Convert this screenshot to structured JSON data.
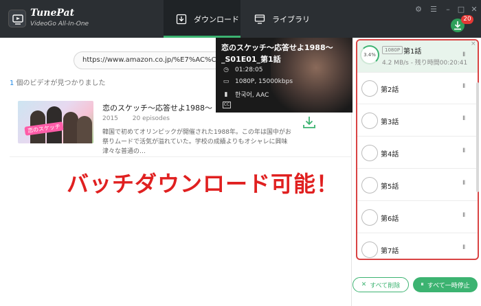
{
  "app": {
    "brand": "TunePat",
    "subtitle": "VideoGo All-In-One"
  },
  "nav": {
    "download": "ダウンロード",
    "library": "ライブラリ"
  },
  "badge": {
    "count": "20"
  },
  "search": {
    "url": "https://www.amazon.co.jp/%E7%AC%C19%E8%"
  },
  "results": {
    "count": "1",
    "suffix": " 個のビデオが見つかりました"
  },
  "video": {
    "title": "恋のスケッチ～応答せよ1988～",
    "year": "2015",
    "episodes": "20 episodes",
    "description": "韓国で初めてオリンピックが開催された1988年。この年は国中がお祭りムードで活気が溢れていた。学校の成績よりもオシャレに興味津々な普通の…",
    "thumb_tag": "恋のスケッチ"
  },
  "popover": {
    "title": "恋のスケッチ～応答せよ1988～_S01E01_第1話",
    "duration": "01:28:05",
    "quality": "1080P, 15000kbps",
    "audio": "한국어, AAC",
    "cc_icon": "CC"
  },
  "promo": "バッチダウンロード可能！",
  "queue": {
    "active": {
      "percent": "3.4%",
      "quality": "1080P",
      "title": "第1話",
      "speed": "4.2 MB/s - 残り時間00:20:41",
      "progress": 0.034
    },
    "items": [
      {
        "label": "第2話"
      },
      {
        "label": "第3話"
      },
      {
        "label": "第4話"
      },
      {
        "label": "第5話"
      },
      {
        "label": "第6話"
      },
      {
        "label": "第7話"
      }
    ],
    "pause_glyph": "II",
    "close_glyph": "×"
  },
  "actions": {
    "remove_all": "すべて削除",
    "pause_all": "すべて一時停止"
  },
  "colors": {
    "accent": "#3cb371",
    "highlight_border": "#d94343",
    "promo_text": "#e02020",
    "titlebar": "#2b2f33"
  }
}
